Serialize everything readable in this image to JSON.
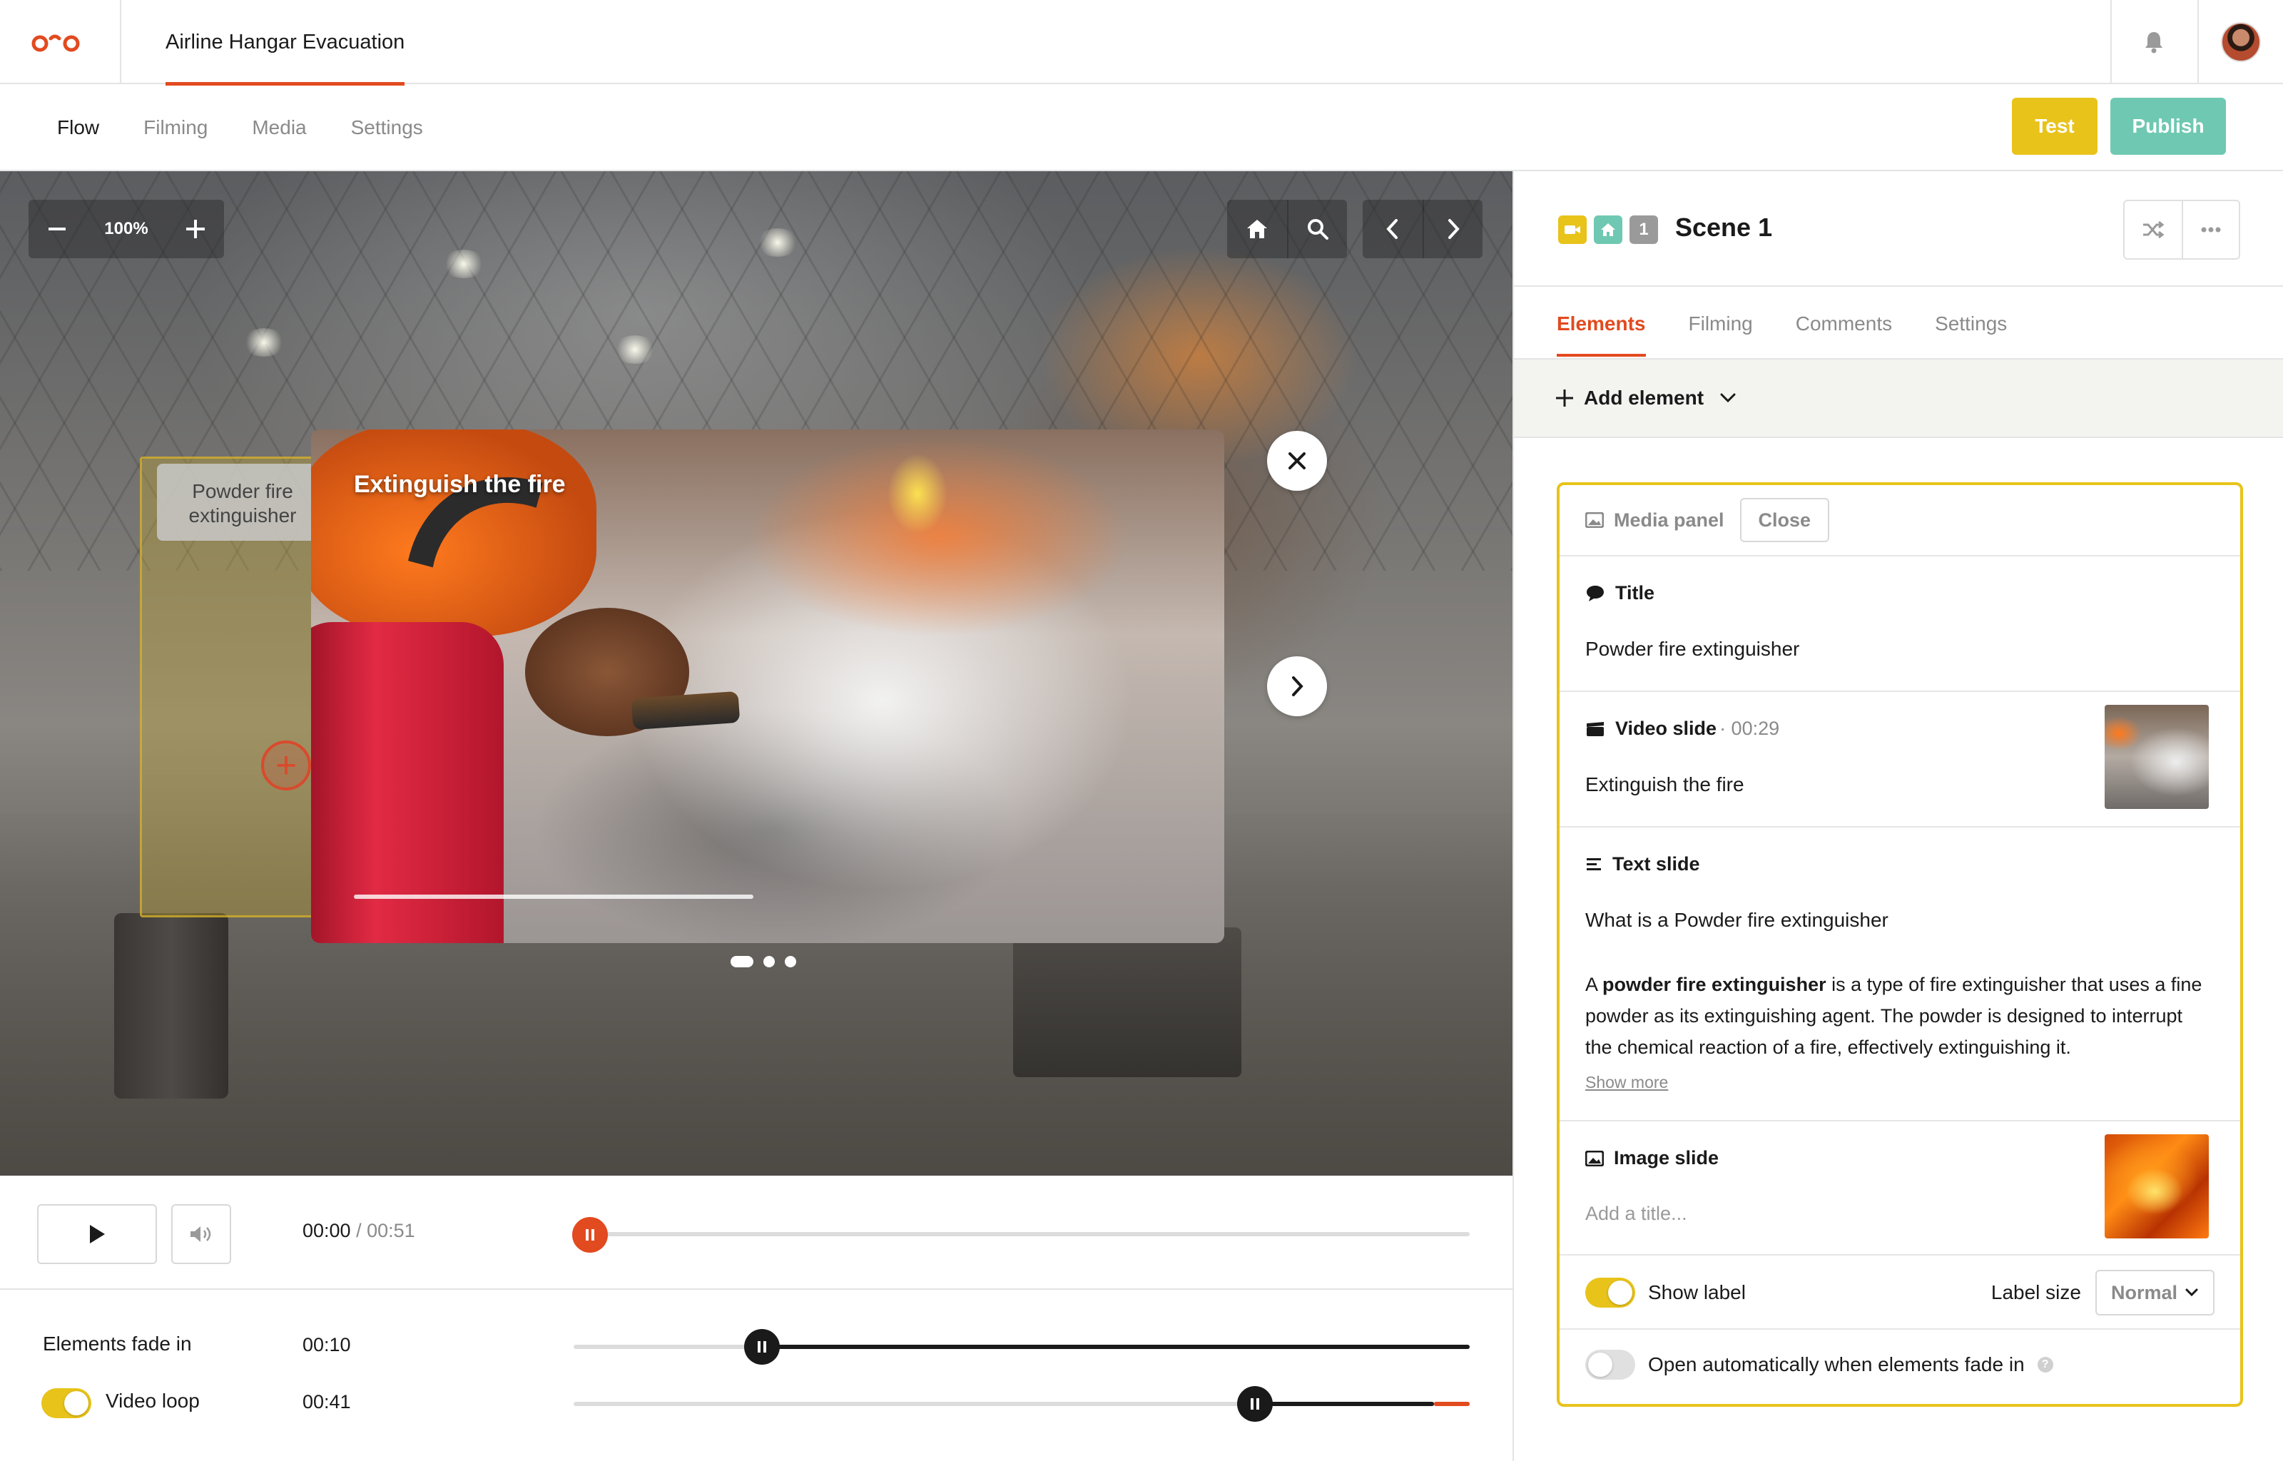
{
  "header": {
    "project_title": "Airline Hangar Evacuation",
    "icons": {
      "logo": "logo-icon",
      "bell": "bell-icon",
      "avatar": "avatar"
    }
  },
  "nav": {
    "tabs": [
      {
        "label": "Flow",
        "active": true
      },
      {
        "label": "Filming",
        "active": false
      },
      {
        "label": "Media",
        "active": false
      },
      {
        "label": "Settings",
        "active": false
      }
    ],
    "test_label": "Test",
    "publish_label": "Publish"
  },
  "viewer": {
    "zoom": "100%",
    "hotspot_label": "Powder fire extinguisher",
    "media_card": {
      "title": "Extinguish the fire",
      "slides_count": 3,
      "active_slide": 1,
      "progress": 0.44
    }
  },
  "playback": {
    "current_time": "00:00",
    "separator": " / ",
    "total_time": "00:51",
    "progress": 0.0
  },
  "timings": {
    "fade_in": {
      "label": "Elements fade in",
      "value": "00:10",
      "position": 0.21
    },
    "video_loop": {
      "label": "Video loop",
      "value": "00:41",
      "enabled": true,
      "position": 0.76
    }
  },
  "scene": {
    "title": "Scene 1",
    "badge_number": "1",
    "tabs": [
      {
        "label": "Elements",
        "active": true
      },
      {
        "label": "Filming",
        "active": false
      },
      {
        "label": "Comments",
        "active": false
      },
      {
        "label": "Settings",
        "active": false
      }
    ],
    "add_element_label": "Add element"
  },
  "media_panel": {
    "header_label": "Media panel",
    "close_label": "Close",
    "title_section": {
      "label": "Title",
      "value": "Powder fire extinguisher"
    },
    "video_slide": {
      "label": "Video slide",
      "duration": "· 00:29",
      "value": "Extinguish the fire"
    },
    "text_slide": {
      "label": "Text slide",
      "heading": "What is a Powder fire extinguisher",
      "body_prefix": "A ",
      "body_bold": "powder fire extinguisher",
      "body_rest": " is a type of fire extinguisher that uses a fine powder as its extinguishing agent. The powder is designed to interrupt the chemical reaction of a fire, effectively extinguishing it.",
      "show_more": "Show more"
    },
    "image_slide": {
      "label": "Image slide",
      "placeholder": "Add a title..."
    },
    "show_label": {
      "label": "Show label",
      "enabled": true
    },
    "label_size": {
      "label": "Label size",
      "value": "Normal"
    },
    "auto_open": {
      "label": "Open automatically when elements fade in",
      "enabled": false
    }
  },
  "colors": {
    "accent": "#e24a1f",
    "test": "#e8c31a",
    "publish": "#6fc8b2",
    "badge_video": "#e8c31a",
    "badge_home": "#6fc8b2",
    "badge_number": "#9a9a9a"
  }
}
